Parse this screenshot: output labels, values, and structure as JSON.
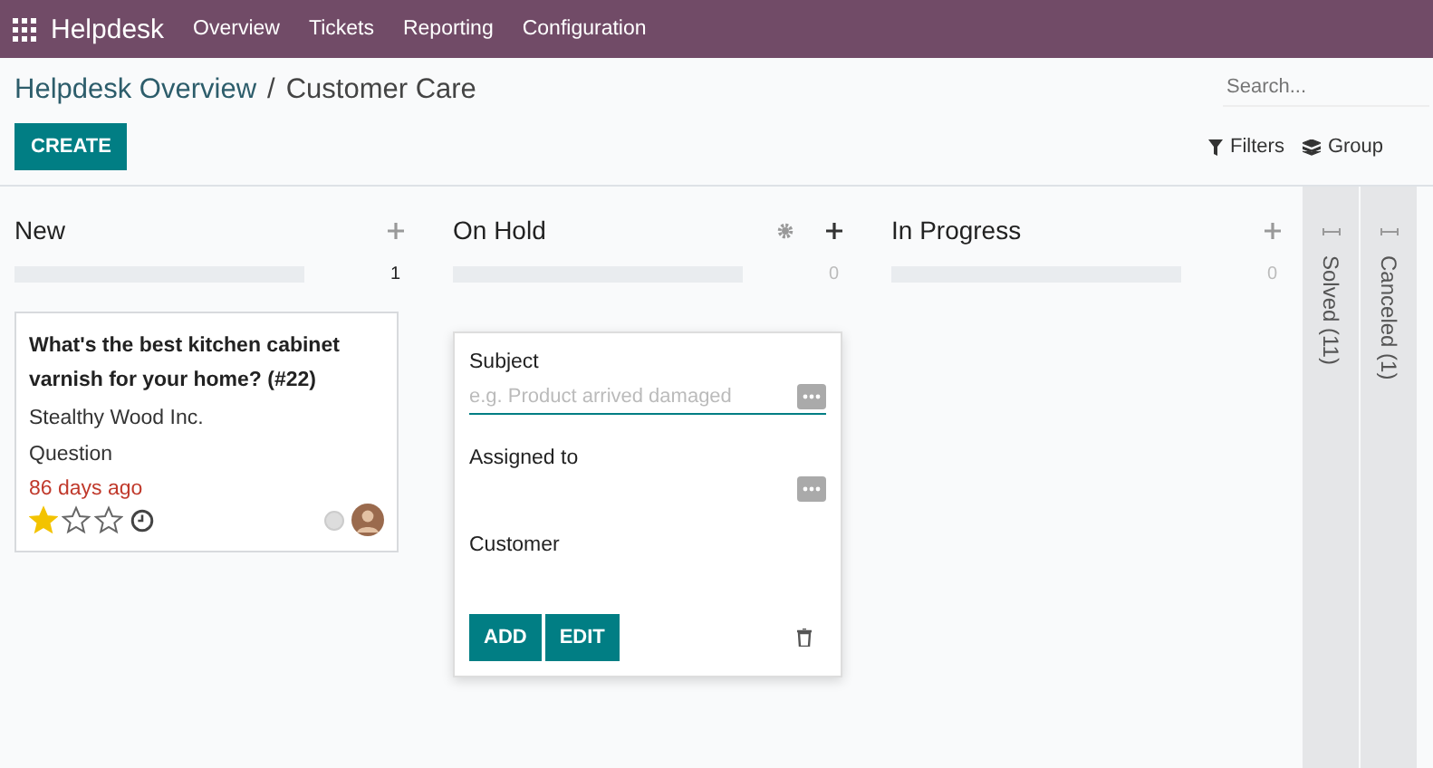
{
  "navbar": {
    "app": "Helpdesk",
    "menu": [
      "Overview",
      "Tickets",
      "Reporting",
      "Configuration"
    ]
  },
  "breadcrumb": {
    "parent": "Helpdesk Overview",
    "separator": "/",
    "current": "Customer Care"
  },
  "create_button": "CREATE",
  "search": {
    "placeholder": "Search..."
  },
  "filters": [
    "Filters",
    "Group"
  ],
  "columns": [
    {
      "title": "New",
      "count": "1",
      "settings": false,
      "cards": [
        {
          "title": "What's the best kitchen cabinet varnish for your home? (#22)",
          "customer": "Stealthy Wood Inc.",
          "type": "Question",
          "age": "86 days ago",
          "stars": 1
        }
      ]
    },
    {
      "title": "On Hold",
      "count": "0",
      "settings": true,
      "quick_create": {
        "subject_label": "Subject",
        "subject_placeholder": "e.g. Product arrived damaged",
        "assigned_label": "Assigned to",
        "customer_label": "Customer",
        "buttons": [
          "ADD",
          "EDIT"
        ]
      }
    },
    {
      "title": "In Progress",
      "count": "0",
      "settings": false
    }
  ],
  "folded_columns": [
    "Solved (11)",
    "Canceled (1)"
  ]
}
